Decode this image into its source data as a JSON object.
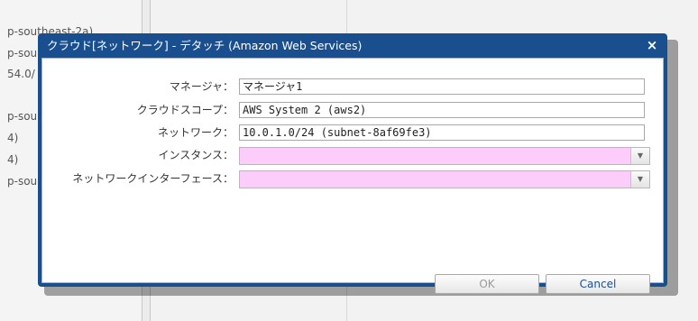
{
  "background": {
    "list_fragments": [
      "p-southeast-2a)",
      "p-sou",
      "54.0/",
      "p-sou",
      "4)",
      "4)",
      "p-sou"
    ]
  },
  "dialog": {
    "title": "クラウド[ネットワーク] - デタッチ (Amazon Web Services)",
    "close_glyph": "×",
    "fields": {
      "manager": {
        "label": "マネージャ：",
        "value": "マネージャ1"
      },
      "cloud_scope": {
        "label": "クラウドスコープ：",
        "value": "AWS System 2 (aws2)"
      },
      "network": {
        "label": "ネットワーク：",
        "value": "10.0.1.0/24 (subnet-8af69fe3)"
      },
      "instance": {
        "label": "インスタンス：",
        "value": ""
      },
      "network_interface": {
        "label": "ネットワークインターフェース：",
        "value": ""
      }
    },
    "buttons": {
      "ok": "OK",
      "cancel": "Cancel"
    },
    "colors": {
      "title_bar": "#1a4f8f",
      "required_select": "#fccdfb"
    }
  }
}
